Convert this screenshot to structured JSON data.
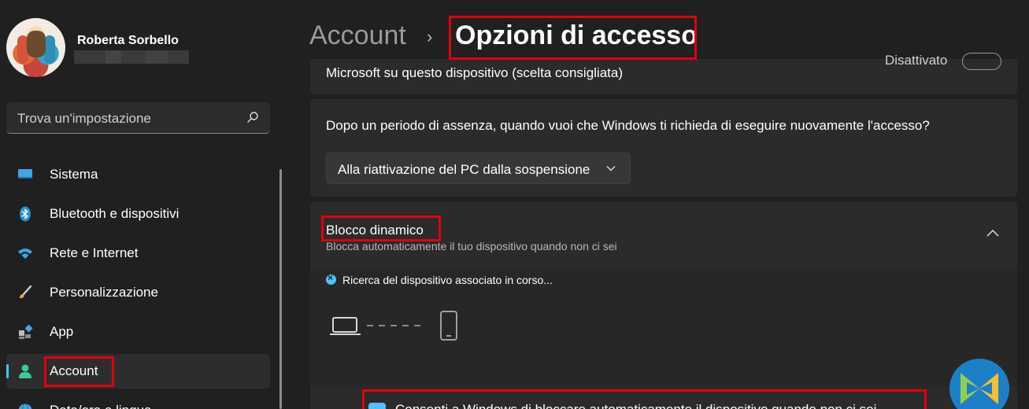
{
  "user": {
    "name": "Roberta Sorbello"
  },
  "search": {
    "placeholder": "Trova un'impostazione"
  },
  "sidebar": {
    "items": [
      {
        "label": "Sistema",
        "icon": "monitor-icon"
      },
      {
        "label": "Bluetooth e dispositivi",
        "icon": "bluetooth-icon"
      },
      {
        "label": "Rete e Internet",
        "icon": "wifi-icon"
      },
      {
        "label": "Personalizzazione",
        "icon": "brush-icon"
      },
      {
        "label": "App",
        "icon": "apps-icon"
      },
      {
        "label": "Account",
        "icon": "account-icon",
        "selected": true
      },
      {
        "label": "Data/ora e lingua",
        "icon": "globe-icon"
      }
    ]
  },
  "header": {
    "parent": "Account",
    "separator": "›",
    "title": "Opzioni di accesso"
  },
  "cards": {
    "top": {
      "text": "Microsoft su questo dispositivo (scelta consigliata)",
      "status": "Disattivato"
    },
    "away": {
      "question": "Dopo un periodo di assenza, quando vuoi che Windows ti richieda di eseguire nuovamente l'accesso?",
      "dropdown_value": "Alla riattivazione del PC dalla sospensione"
    },
    "dynamic_lock": {
      "title": "Blocco dinamico",
      "subtitle": "Blocca automaticamente il tuo dispositivo quando non ci sei",
      "status_text": "Ricerca del dispositivo associato in corso...",
      "checkbox_label": "Consenti a Windows di bloccare automaticamente il dispositivo quando non ci sei"
    }
  },
  "colors": {
    "accent": "#4cc2ff",
    "highlight": "#e0000f",
    "background": "#202020",
    "card": "#2b2b2b"
  }
}
